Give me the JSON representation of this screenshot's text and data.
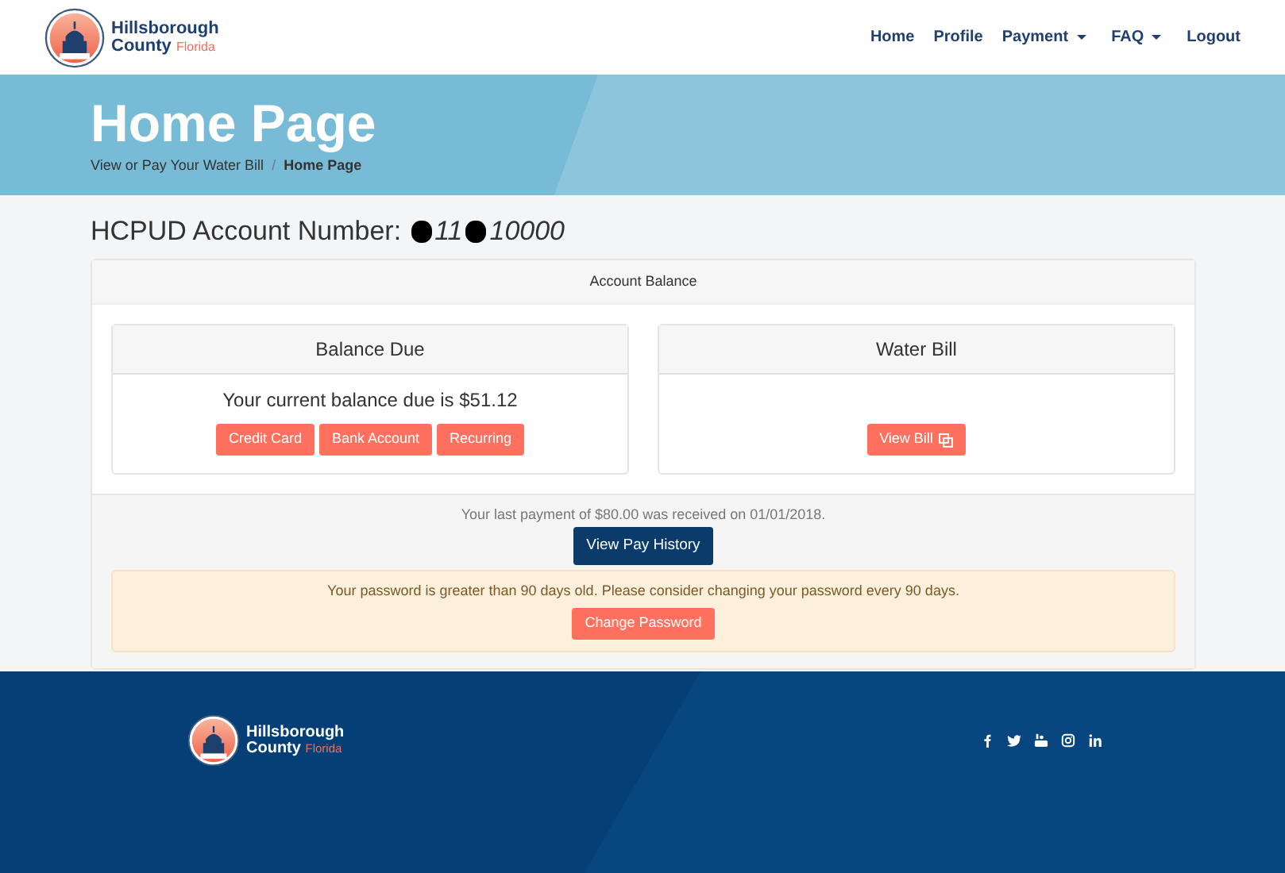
{
  "brand": {
    "line_1": "Hillsborough",
    "line_2": "County",
    "line_3": "Florida"
  },
  "nav": [
    {
      "label": "Home",
      "kind": "link"
    },
    {
      "label": "Profile",
      "kind": "link"
    },
    {
      "label": "Payment",
      "kind": "dropdown"
    },
    {
      "label": "FAQ",
      "kind": "dropdown"
    },
    {
      "label": "Logout",
      "kind": "link"
    }
  ],
  "banner": {
    "title": "Home Page",
    "separator": "/",
    "breadcrumb": [
      {
        "label": "View or Pay Your Water Bill",
        "current": false
      },
      {
        "label": "Home Page",
        "current": true
      }
    ]
  },
  "account_number": {
    "label": "HCPUD Account Number:",
    "segments": [
      {
        "kind": "redacted"
      },
      {
        "kind": "text",
        "text": "11"
      },
      {
        "kind": "redacted"
      },
      {
        "kind": "text",
        "text": "10000"
      }
    ]
  },
  "account_balance": {
    "header": "Account Balance",
    "panels": [
      {
        "kind": "balance",
        "title": "Balance Due",
        "message": "Your current balance due is $51.12",
        "buttons": [
          "Credit Card",
          "Bank Account",
          "Recurring"
        ]
      },
      {
        "kind": "bill",
        "title": "Water Bill",
        "buttons": [
          "View Bill"
        ]
      }
    ],
    "last_payment": "Your last payment of $80.00 was received on 01/01/2018.",
    "history_button": "View Pay History",
    "alert": {
      "message": "Your password is greater than 90 days old. Please consider changing your password every 90 days.",
      "button": "Change Password"
    }
  },
  "footer": {
    "brand": {
      "line_1": "Hillsborough",
      "line_2": "County",
      "line_3": "Florida"
    },
    "social": [
      {
        "kind": "f"
      },
      {
        "kind": "bird"
      },
      {
        "kind": "tube"
      },
      {
        "kind": "camera"
      },
      {
        "kind": "in"
      }
    ]
  }
}
